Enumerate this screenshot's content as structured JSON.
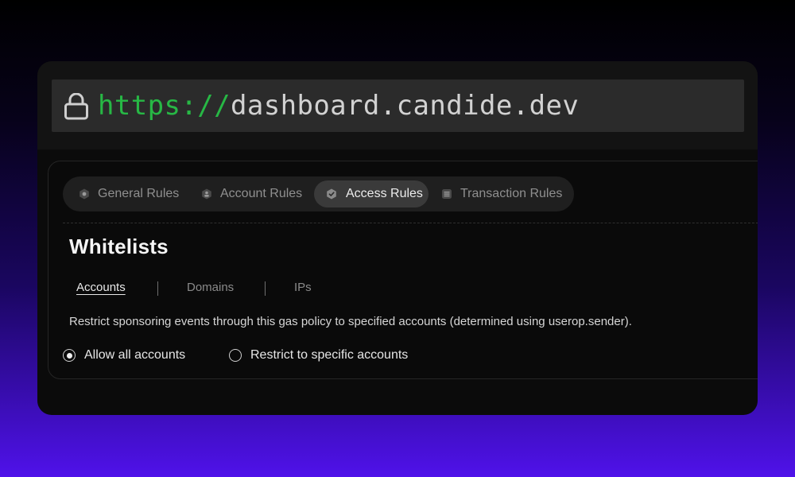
{
  "browser": {
    "url_scheme": "https://",
    "url_host": "dashboard.candide.dev",
    "icons": {
      "lock": "lock-icon"
    },
    "colors": {
      "scheme": "#27b845",
      "host": "#d2d2d2"
    }
  },
  "rule_tabs": [
    {
      "label": "General Rules",
      "icon": "hexagon-icon",
      "active": false
    },
    {
      "label": "Account Rules",
      "icon": "user-shield-icon",
      "active": false
    },
    {
      "label": "Access Rules",
      "icon": "check-shield-icon",
      "active": true
    },
    {
      "label": "Transaction Rules",
      "icon": "list-icon",
      "active": false
    }
  ],
  "section": {
    "title": "Whitelists",
    "subtabs": [
      {
        "label": "Accounts",
        "active": true
      },
      {
        "label": "Domains",
        "active": false
      },
      {
        "label": "IPs",
        "active": false
      }
    ],
    "description": "Restrict sponsoring events through this gas policy to specified accounts (determined using userop.sender).",
    "options": [
      {
        "label": "Allow all accounts",
        "selected": true
      },
      {
        "label": "Restrict to specific accounts",
        "selected": false
      }
    ]
  }
}
